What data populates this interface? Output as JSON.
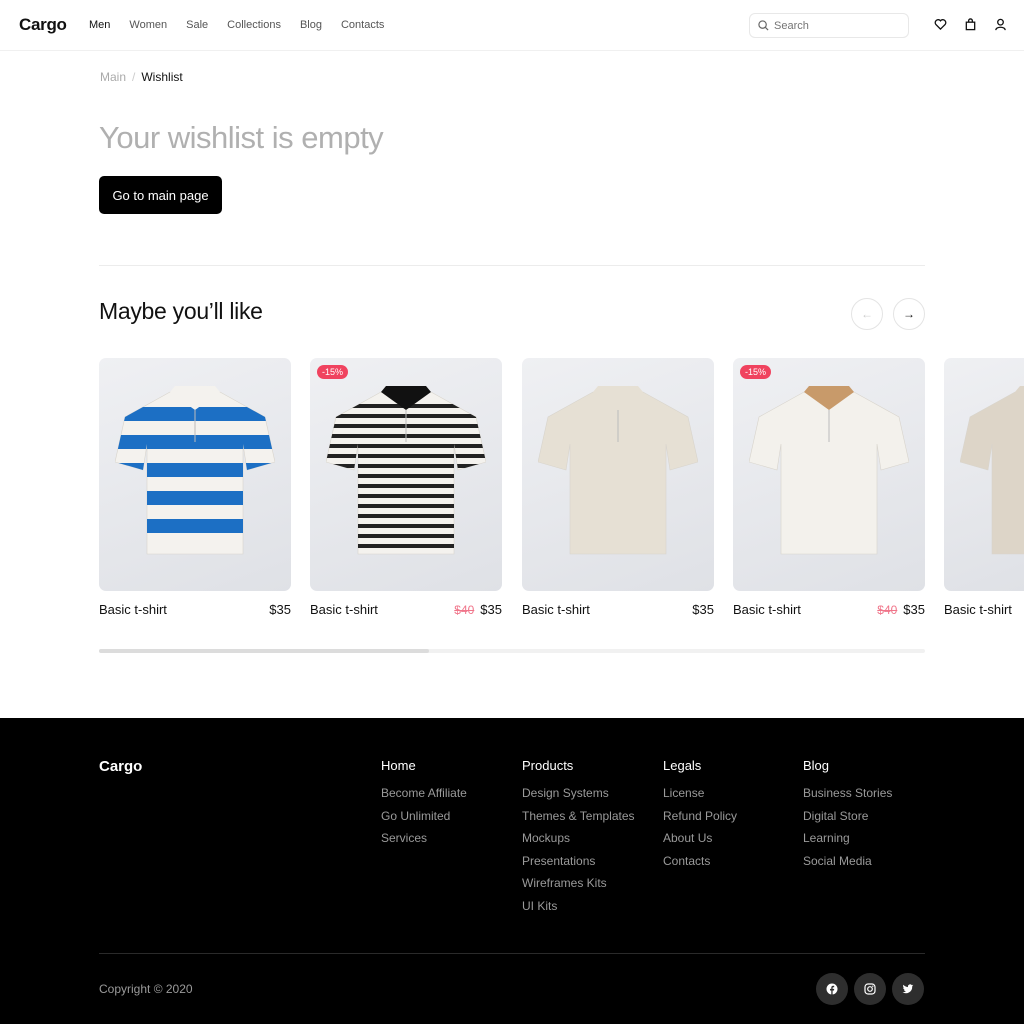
{
  "header": {
    "logo": "Cargo",
    "nav": [
      "Men",
      "Women",
      "Sale",
      "Collections",
      "Blog",
      "Contacts"
    ],
    "search_placeholder": "Search"
  },
  "breadcrumb": {
    "root": "Main",
    "sep": "/",
    "current": "Wishlist"
  },
  "empty": {
    "title": "Your wishlist is empty",
    "button": "Go to main page"
  },
  "recommend": {
    "title": "Maybe you’ll like",
    "prev": "←",
    "next": "→",
    "scroll_position": 0.4
  },
  "products": [
    {
      "name": "Basic t-shirt",
      "price": "$35",
      "old_price": "",
      "badge": "",
      "color": "#1c6fc4",
      "style": "wide-stripes"
    },
    {
      "name": "Basic t-shirt",
      "price": "$35",
      "old_price": "$40",
      "badge": "-15%",
      "color": "#222222",
      "style": "thin-stripes"
    },
    {
      "name": "Basic t-shirt",
      "price": "$35",
      "old_price": "",
      "badge": "",
      "color": "#e6e0d4",
      "style": "plain"
    },
    {
      "name": "Basic t-shirt",
      "price": "$35",
      "old_price": "$40",
      "badge": "-15%",
      "color": "#f3f1ec",
      "style": "tan-collar"
    },
    {
      "name": "Basic t-shirt",
      "price": "",
      "old_price": "",
      "badge": "",
      "color": "#ddd5c8",
      "style": "plain"
    }
  ],
  "footer": {
    "logo": "Cargo",
    "columns": [
      {
        "title": "Home",
        "links": [
          "Become Affiliate",
          "Go Unlimited",
          "Services"
        ]
      },
      {
        "title": "Products",
        "links": [
          "Design Systems",
          "Themes & Templates",
          "Mockups",
          "Presentations",
          "Wireframes Kits",
          "UI Kits"
        ]
      },
      {
        "title": "Legals",
        "links": [
          "License",
          "Refund Policy",
          "About Us",
          "Contacts"
        ]
      },
      {
        "title": "Blog",
        "links": [
          "Business Stories",
          "Digital Store",
          "Learning",
          "Social Media"
        ]
      }
    ],
    "copyright": "Copyright © 2020",
    "social": [
      "facebook-icon",
      "instagram-icon",
      "twitter-icon"
    ]
  },
  "colors": {
    "accent": "#000000",
    "badge": "#f0435f"
  }
}
